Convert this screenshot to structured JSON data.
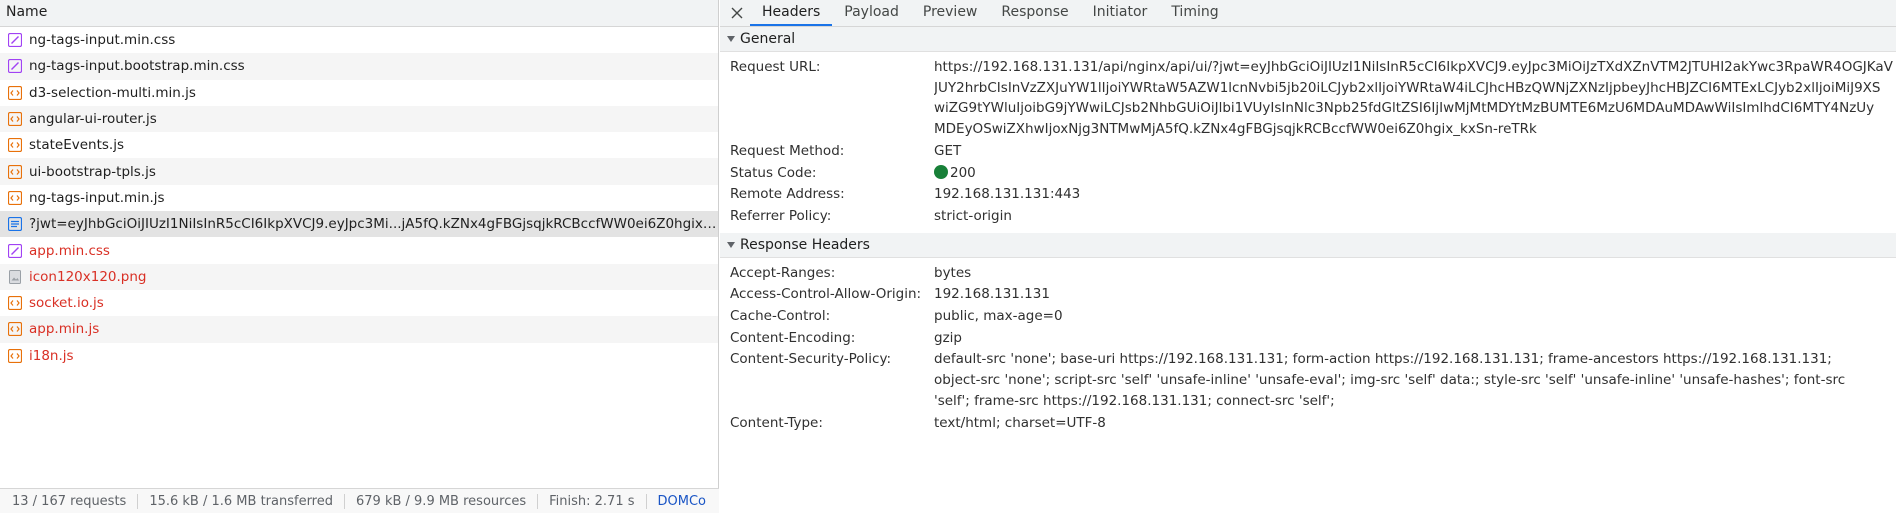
{
  "left": {
    "header": "Name",
    "files": [
      {
        "name": "ng-tags-input.min.css",
        "icon": "css-file-icon",
        "error": false
      },
      {
        "name": "ng-tags-input.bootstrap.min.css",
        "icon": "css-file-icon",
        "error": false
      },
      {
        "name": "d3-selection-multi.min.js",
        "icon": "script-file-icon",
        "error": false
      },
      {
        "name": "angular-ui-router.js",
        "icon": "script-file-icon",
        "error": false
      },
      {
        "name": "stateEvents.js",
        "icon": "script-file-icon",
        "error": false
      },
      {
        "name": "ui-bootstrap-tpls.js",
        "icon": "script-file-icon",
        "error": false
      },
      {
        "name": "ng-tags-input.min.js",
        "icon": "script-file-icon",
        "error": false
      },
      {
        "name": "?jwt=eyJhbGciOiJIUzI1NiIsInR5cCI6IkpXVCJ9.eyJpc3Mi...jA5fQ.kZNx4gFBGjsqjkRCBccfWW0ei6Z0hgix_...",
        "icon": "document-file-icon",
        "error": false
      },
      {
        "name": "app.min.css",
        "icon": "css-file-icon",
        "error": true
      },
      {
        "name": "icon120x120.png",
        "icon": "image-file-icon",
        "error": true
      },
      {
        "name": "socket.io.js",
        "icon": "script-file-icon",
        "error": true
      },
      {
        "name": "app.min.js",
        "icon": "script-file-icon",
        "error": true
      },
      {
        "name": "i18n.js",
        "icon": "script-file-icon",
        "error": true
      }
    ],
    "status": {
      "requests": "13 / 167 requests",
      "transferred": "15.6 kB / 1.6 MB transferred",
      "resources": "679 kB / 9.9 MB resources",
      "finish": "Finish: 2.71 s",
      "domcontent": "DOMCo"
    }
  },
  "right": {
    "tabs": [
      "Headers",
      "Payload",
      "Preview",
      "Response",
      "Initiator",
      "Timing"
    ],
    "active_tab": "Headers",
    "general": {
      "title": "General",
      "request_url_label": "Request URL:",
      "request_url_lines": [
        "https://192.168.131.131/api/nginx/api/ui/?jwt=eyJhbGciOiJIUzI1NiIsInR5cCI6IkpXVCJ9.eyJpc3MiOiJzTXdXZnVTM2JTUHI2akYwc3RpaWR4OGJKaV",
        "JUY2hrbCIsInVzZXJuYW1lIjoiYWRtaW5AZW1lcnNvbi5jb20iLCJyb2xlIjoiYWRtaW4iLCJhcHBzQWNjZXNzIjpbeyJhcHBJZCI6MTExLCJyb2xlIjoiMiJ9XS",
        "wiZG9tYWluIjoibG9jYWwiLCJsb2NhbGUiOiJlbi1VUyIsInNlc3Npb25fdGltZSI6IjIwMjMtMDYtMzBUMTE6MzU6MDAuMDAwWiIsImlhdCI6MTY4NzUy",
        "MDEyOSwiZXhwIjoxNjg3NTMwMjA5fQ.kZNx4gFBGjsqjkRCBccfWW0ei6Z0hgix_kxSn-reTRk"
      ],
      "request_method_label": "Request Method:",
      "request_method": "GET",
      "status_code_label": "Status Code:",
      "status_code": "200",
      "status_color": "#188038",
      "remote_address_label": "Remote Address:",
      "remote_address": "192.168.131.131:443",
      "referrer_policy_label": "Referrer Policy:",
      "referrer_policy": "strict-origin"
    },
    "response_headers": {
      "title": "Response Headers",
      "accept_ranges_label": "Accept-Ranges:",
      "accept_ranges": "bytes",
      "acao_label": "Access-Control-Allow-Origin:",
      "acao": "192.168.131.131",
      "cache_control_label": "Cache-Control:",
      "cache_control": "public, max-age=0",
      "content_encoding_label": "Content-Encoding:",
      "content_encoding": "gzip",
      "csp_label": "Content-Security-Policy:",
      "csp": "default-src 'none'; base-uri https://192.168.131.131; form-action https://192.168.131.131; frame-ancestors https://192.168.131.131; object-src 'none'; script-src 'self' 'unsafe-inline' 'unsafe-eval'; img-src 'self' data:; style-src 'self' 'unsafe-inline' 'unsafe-hashes'; font-src 'self'; frame-src https://192.168.131.131; connect-src 'self';",
      "content_type_label": "Content-Type:",
      "content_type": "text/html; charset=UTF-8"
    }
  }
}
